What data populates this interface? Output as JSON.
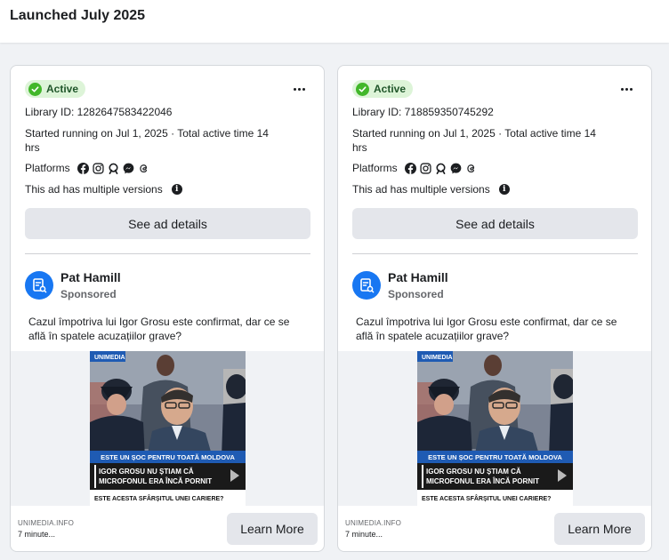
{
  "header": {
    "title": "Launched July 2025"
  },
  "common": {
    "platforms_label": "Platforms",
    "platform_icons": [
      "facebook-icon",
      "instagram-icon",
      "audience-network-icon",
      "messenger-icon",
      "threads-icon"
    ],
    "versions_text": "This ad has multiple versions",
    "details_button": "See ad details",
    "learn_more_button": "Learn More"
  },
  "colors": {
    "active_badge_bg": "#ddf4d8",
    "active_check": "#42b72a",
    "avatar": "#1877f2"
  },
  "ads": [
    {
      "status": "Active",
      "library_id": "Library ID: 1282647583422046",
      "started": "Started running on Jul 1, 2025 · Total active time 14 hrs",
      "advertiser": "Pat Hamill",
      "sponsored": "Sponsored",
      "body": "Cazul împotriva lui Igor Grosu este confirmat, dar ce se află în spatele acuzațiilor grave?",
      "creative": {
        "brand": "UNIMEDIA",
        "banner": "ESTE UN ȘOC PENTRU TOATĂ MOLDOVA",
        "quote_line1": "IGOR GROSU NU ȘTIAM CĂ",
        "quote_line2": "MICROFONUL ERA ÎNCĂ PORNIT",
        "question": "ESTE ACESTA SFÂRȘITUL UNEI CARIERE?"
      },
      "domain": "UNIMEDIA.INFO",
      "time": "7 minute..."
    },
    {
      "status": "Active",
      "library_id": "Library ID: 718859350745292",
      "started": "Started running on Jul 1, 2025 · Total active time 14 hrs",
      "advertiser": "Pat Hamill",
      "sponsored": "Sponsored",
      "body": "Cazul împotriva lui Igor Grosu este confirmat, dar ce se află în spatele acuzațiilor grave?",
      "creative": {
        "brand": "UNIMEDIA",
        "banner": "ESTE UN ȘOC PENTRU TOATĂ MOLDOVA",
        "quote_line1": "IGOR GROSU NU ȘTIAM CĂ",
        "quote_line2": "MICROFONUL ERA ÎNCĂ PORNIT",
        "question": "ESTE ACESTA SFÂRȘITUL UNEI CARIERE?"
      },
      "domain": "UNIMEDIA.INFO",
      "time": "7 minute..."
    }
  ]
}
